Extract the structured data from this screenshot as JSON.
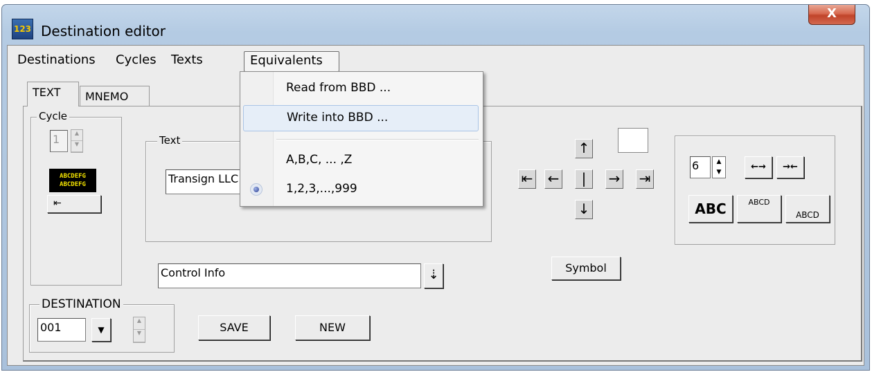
{
  "window": {
    "title": "Destination editor",
    "close_label": "X",
    "icon_label": "123"
  },
  "menubar": {
    "items": [
      "Destinations",
      "Cycles",
      "Texts",
      "Equivalents"
    ]
  },
  "tabs": [
    "TEXT",
    "MNEMO"
  ],
  "cycle_group": {
    "title": "Cycle",
    "value": "1",
    "preview_line1": "ABCDEFG",
    "preview_line2": "ABCDEFG",
    "align_label": "⇤"
  },
  "text_group": {
    "title": "Text",
    "value": "Transign LLC"
  },
  "control_info": {
    "value": "Control Info",
    "button_label": "⇣"
  },
  "destination_group": {
    "title": "DESTINATION",
    "value": "001",
    "dropdown_label": "▼"
  },
  "buttons": {
    "save": "SAVE",
    "new": "NEW",
    "symbol": "Symbol"
  },
  "arrows": {
    "up": "↑",
    "down": "↓",
    "left_end": "⇤",
    "left": "←",
    "center": "|",
    "right": "→",
    "right_end": "⇥"
  },
  "format_group": {
    "size_value": "6",
    "widen_label": "←→",
    "narrow_label": "→←",
    "abc_bold": "ABC",
    "abcd_small": "ABCD",
    "abcd_low": "ABCD"
  },
  "equivalents_menu": {
    "items": [
      "Read from BBD ...",
      "Write into BBD ...",
      "A,B,C, ... ,Z",
      "1,2,3,...,999"
    ],
    "selected_index": 3,
    "hover_index": 1
  },
  "colors": {
    "titlebar": "#b4cbe3",
    "close_button": "#c0442a",
    "preview_background": "#000000",
    "preview_text": "#f5e400",
    "menu_hover": "#e6eef8"
  }
}
